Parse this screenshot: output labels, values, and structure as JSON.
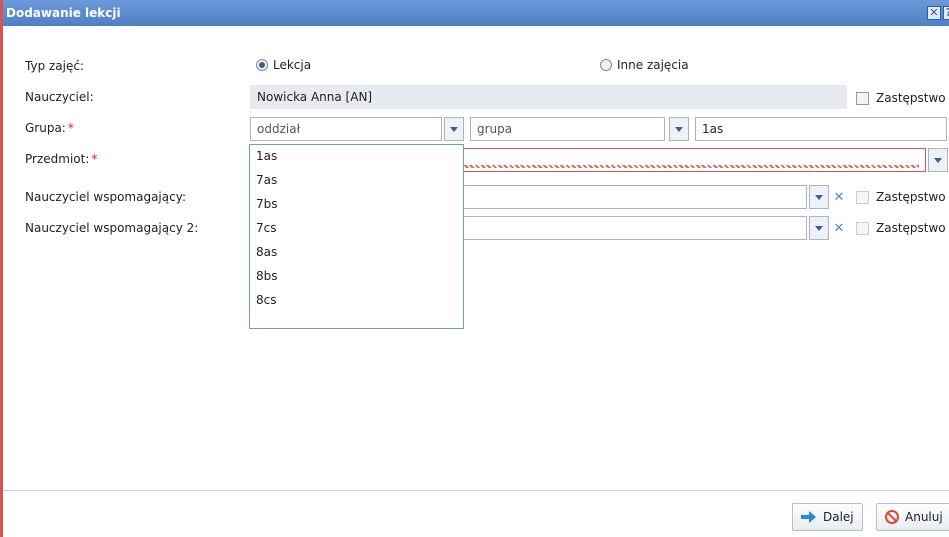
{
  "window": {
    "title": "Dodawanie lekcji"
  },
  "form": {
    "typ_label": "Typ zajęć:",
    "radio_lekcja": "Lekcja",
    "radio_inne": "Inne zajęcia",
    "nauczyciel_label": "Nauczyciel:",
    "nauczyciel_value": "Nowicka Anna [AN]",
    "zastepstwo_label": "Zastępstwo",
    "grupa_label": "Grupa:",
    "required_mark": "*",
    "grupa_oddzial_placeholder": "oddział",
    "grupa_grupa_placeholder": "grupa",
    "grupa_value": "1as",
    "przedmiot_label": "Przedmiot:",
    "wspomagajacy_label": "Nauczyciel wspomagający:",
    "wspomagajacy2_label": "Nauczyciel wspomagający 2:"
  },
  "dropdown": {
    "items": [
      "1as",
      "7as",
      "7bs",
      "7cs",
      "8as",
      "8bs",
      "8cs"
    ]
  },
  "footer": {
    "next_label": "Dalej",
    "cancel_label": "Anuluj"
  },
  "colors": {
    "titlebar": "#5c8ed4",
    "accent": "#3a5f95",
    "required": "#d9251d",
    "invalid_border": "#d9534f"
  },
  "icons": [
    "close-icon",
    "help-icon",
    "chevron-down-icon",
    "clear-x-icon",
    "arrow-right-icon",
    "cancel-icon"
  ]
}
